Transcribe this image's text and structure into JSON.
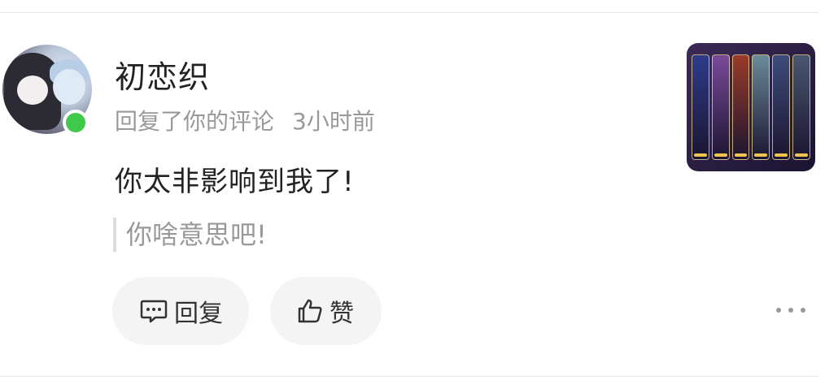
{
  "comment": {
    "username": "初恋织",
    "action": "回复了你的评论",
    "time": "3小时前",
    "text": "你太非影响到我了!",
    "quoted": "你啥意思吧!"
  },
  "actions": {
    "reply_label": "回复",
    "like_label": "赞"
  },
  "thumbnail": {
    "card_colors": [
      "#2d3b8a",
      "#7a4a9a",
      "#9a3b2a",
      "#6a8a9a",
      "#3d4c7a",
      "#4a5670"
    ]
  },
  "colors": {
    "online_status": "#3fc84a",
    "pill_background": "#f4f4f4",
    "muted_text": "#999999"
  }
}
